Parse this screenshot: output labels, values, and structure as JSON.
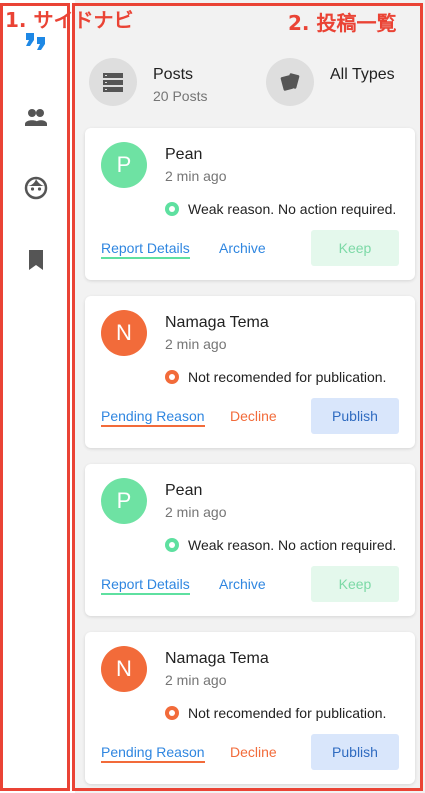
{
  "annotations": {
    "sidebar_label": "1. サイドナビ",
    "list_label": "2. 投稿一覧"
  },
  "sidebar": {
    "items": [
      {
        "icon": "quote-icon",
        "color": "#1e88e5"
      },
      {
        "icon": "people-icon",
        "color": "#616161"
      },
      {
        "icon": "face-icon",
        "color": "#616161"
      },
      {
        "icon": "bookmark-icon",
        "color": "#616161"
      }
    ]
  },
  "summary": {
    "posts": {
      "title": "Posts",
      "count": "20 Posts",
      "icon": "list-icon"
    },
    "types": {
      "title": "All Types",
      "icon": "cards-icon"
    }
  },
  "cards": [
    {
      "initial": "P",
      "name": "Pean",
      "time": "2 min ago",
      "status": "Weak reason. No action required.",
      "status_color": "#5ee0a0",
      "link": "Report Details",
      "action": "Archive",
      "cta": "Keep",
      "avatar_color": "#6ee2a3",
      "link_color": "#2f86e0",
      "action_color": "#2f86e0",
      "cta_bg": "#e4f8ec",
      "cta_color": "#7cd9a6"
    },
    {
      "initial": "N",
      "name": "Namaga Tema",
      "time": "2 min ago",
      "status": "Not recomended for publication.",
      "status_color": "#f26b3a",
      "link": "Pending Reason",
      "action": "Decline",
      "cta": "Publish",
      "avatar_color": "#f26b3a",
      "link_color": "#2f86e0",
      "action_color": "#f26b3a",
      "cta_bg": "#d9e6fb",
      "cta_color": "#2f6bc0",
      "link_underline": "#f26b3a"
    },
    {
      "initial": "P",
      "name": "Pean",
      "time": "2 min ago",
      "status": "Weak reason. No action required.",
      "status_color": "#5ee0a0",
      "link": "Report Details",
      "action": "Archive",
      "cta": "Keep",
      "avatar_color": "#6ee2a3",
      "link_color": "#2f86e0",
      "action_color": "#2f86e0",
      "cta_bg": "#e4f8ec",
      "cta_color": "#7cd9a6"
    },
    {
      "initial": "N",
      "name": "Namaga Tema",
      "time": "2 min ago",
      "status": "Not recomended for publication.",
      "status_color": "#f26b3a",
      "link": "Pending Reason",
      "action": "Decline",
      "cta": "Publish",
      "avatar_color": "#f26b3a",
      "link_color": "#2f86e0",
      "action_color": "#f26b3a",
      "cta_bg": "#d9e6fb",
      "cta_color": "#2f6bc0",
      "link_underline": "#f26b3a"
    }
  ]
}
